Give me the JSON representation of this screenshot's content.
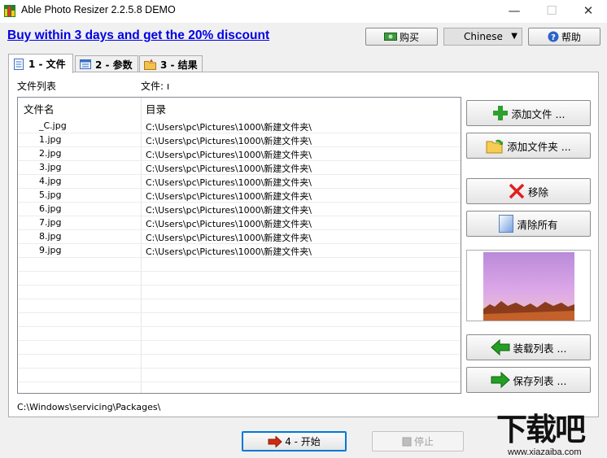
{
  "window": {
    "title": "Able Photo Resizer 2.2.5.8 DEMO",
    "minimize_glyph": "—",
    "maximize_glyph": "☐",
    "close_glyph": "✕"
  },
  "promo": {
    "text": "Buy within 3 days and get the 20% discount"
  },
  "top_buttons": {
    "buy_label": "购买",
    "language_value": "Chinese",
    "help_label": "帮助"
  },
  "tabs": [
    {
      "label": "1 - 文件",
      "icon": "document-list-icon",
      "active": true
    },
    {
      "label": "2 - 参数",
      "icon": "parameters-icon",
      "active": false
    },
    {
      "label": "3 - 结果",
      "icon": "results-icon",
      "active": false
    }
  ],
  "files_panel": {
    "file_list_label": "文件列表",
    "file_count_label": "文件: ı",
    "columns": [
      "文件名",
      "目录"
    ],
    "rows": [
      {
        "name": "_C.jpg",
        "dir": "C:\\Users\\pc\\Pictures\\1000\\新建文件夹\\"
      },
      {
        "name": "1.jpg",
        "dir": "C:\\Users\\pc\\Pictures\\1000\\新建文件夹\\"
      },
      {
        "name": "2.jpg",
        "dir": "C:\\Users\\pc\\Pictures\\1000\\新建文件夹\\"
      },
      {
        "name": "3.jpg",
        "dir": "C:\\Users\\pc\\Pictures\\1000\\新建文件夹\\"
      },
      {
        "name": "4.jpg",
        "dir": "C:\\Users\\pc\\Pictures\\1000\\新建文件夹\\"
      },
      {
        "name": "5.jpg",
        "dir": "C:\\Users\\pc\\Pictures\\1000\\新建文件夹\\"
      },
      {
        "name": "6.jpg",
        "dir": "C:\\Users\\pc\\Pictures\\1000\\新建文件夹\\"
      },
      {
        "name": "7.jpg",
        "dir": "C:\\Users\\pc\\Pictures\\1000\\新建文件夹\\"
      },
      {
        "name": "8.jpg",
        "dir": "C:\\Users\\pc\\Pictures\\1000\\新建文件夹\\"
      },
      {
        "name": "9.jpg",
        "dir": "C:\\Users\\pc\\Pictures\\1000\\新建文件夹\\"
      }
    ],
    "status_path": "C:\\Windows\\servicing\\Packages\\"
  },
  "side_buttons": {
    "add_files": "添加文件 ...",
    "add_folder": "添加文件夹 ...",
    "remove": "移除",
    "clear_all": "清除所有",
    "load_list": "装载列表 ...",
    "save_list": "保存列表 ..."
  },
  "bottom_buttons": {
    "start": "4 - 开始",
    "stop": "停止"
  },
  "watermark": {
    "main": "下载吧",
    "url": "www.xiazaiba.com"
  },
  "colors": {
    "link": "#0000e6",
    "accent_border": "#0078d7",
    "add_icon": "#2ea02e",
    "remove_icon": "#e02020",
    "arrow_icon": "#d22a10"
  }
}
